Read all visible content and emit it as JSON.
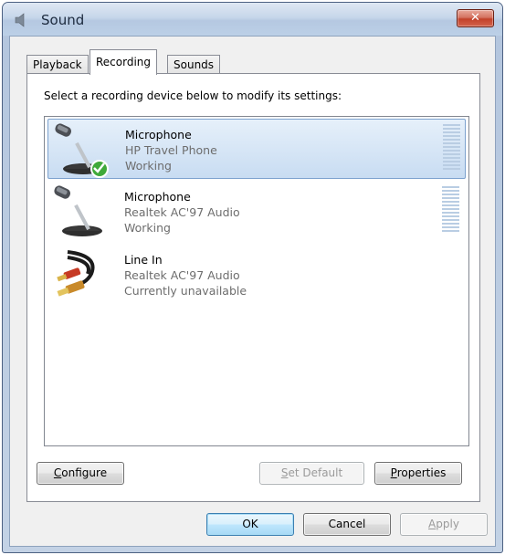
{
  "window": {
    "title": "Sound",
    "close_label": "✕"
  },
  "tabs": [
    {
      "label": "Playback",
      "active": false
    },
    {
      "label": "Recording",
      "active": true
    },
    {
      "label": "Sounds",
      "active": false
    }
  ],
  "panel": {
    "instruction": "Select a recording device below to modify its settings:"
  },
  "devices": [
    {
      "name": "Microphone",
      "description": "HP Travel Phone",
      "status": "Working",
      "icon": "microphone-icon",
      "selected": true,
      "is_default": true
    },
    {
      "name": "Microphone",
      "description": "Realtek AC'97 Audio",
      "status": "Working",
      "icon": "microphone-icon",
      "selected": false,
      "is_default": false
    },
    {
      "name": "Line In",
      "description": "Realtek AC'97 Audio",
      "status": "Currently unavailable",
      "icon": "line-in-cable-icon",
      "selected": false,
      "is_default": false
    }
  ],
  "panel_buttons": {
    "configure": {
      "prefix": "",
      "accel": "C",
      "rest": "onfigure"
    },
    "set_default": {
      "prefix": "",
      "accel": "S",
      "rest": "et Default"
    },
    "properties": {
      "prefix": "",
      "accel": "P",
      "rest": "roperties"
    }
  },
  "dialog_buttons": {
    "ok": "OK",
    "cancel": "Cancel",
    "apply_accel": "A",
    "apply_rest": "pply"
  },
  "colors": {
    "selection_border": "#7da2ce",
    "close_button": "#c2412a",
    "default_check": "#3fa93a"
  }
}
